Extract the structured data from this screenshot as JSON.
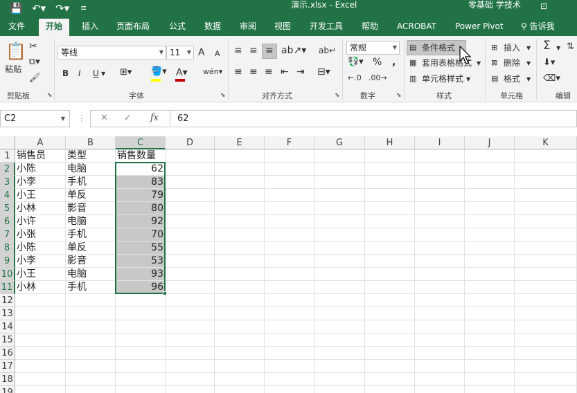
{
  "app": {
    "window_title": "演示.xlsx  -  Excel",
    "user_label": "零基础 学技术"
  },
  "tabs": [
    "文件",
    "开始",
    "插入",
    "页面布局",
    "公式",
    "数据",
    "审阅",
    "视图",
    "开发工具",
    "帮助",
    "ACROBAT",
    "Power Pivot"
  ],
  "active_tab": "开始",
  "tell_me": "告诉我",
  "ribbon": {
    "clipboard": {
      "paste": "粘贴",
      "label": "剪贴板"
    },
    "font": {
      "name": "等线",
      "size": "11",
      "label": "字体",
      "bold": "B",
      "italic": "I",
      "underline": "U",
      "grow": "A",
      "shrink": "A",
      "fill_color": "#ffff00",
      "font_color": "#c00000"
    },
    "alignment": {
      "label": "对齐方式"
    },
    "number": {
      "format": "常规",
      "percent": "%",
      "comma": ",",
      "label": "数字"
    },
    "styles": {
      "conditional": "条件格式",
      "table": "套用表格格式",
      "cell": "单元格样式",
      "label": "样式"
    },
    "cells": {
      "insert": "插入",
      "delete": "删除",
      "format": "格式",
      "label": "单元格"
    },
    "editing": {
      "label": "编辑",
      "sum": "Σ"
    }
  },
  "formula_bar": {
    "name_box": "C2",
    "cancel": "✕",
    "enter": "✓",
    "fx": "fx",
    "value": "62"
  },
  "sheet": {
    "columns": [
      "A",
      "B",
      "C",
      "D",
      "E",
      "F",
      "G",
      "H",
      "I",
      "J",
      "K"
    ],
    "row_numbers": [
      "1",
      "2",
      "3",
      "4",
      "5",
      "6",
      "7",
      "8",
      "9",
      "10",
      "11",
      "12",
      "13",
      "14",
      "15",
      "16",
      "17",
      "18",
      "19"
    ],
    "selected_column": "C",
    "selection": "C2:C11",
    "header": [
      "销售员",
      "类型",
      "销售数量"
    ],
    "rows": [
      [
        "小陈",
        "电脑",
        "62"
      ],
      [
        "小李",
        "手机",
        "83"
      ],
      [
        "小王",
        "单反",
        "79"
      ],
      [
        "小林",
        "影音",
        "80"
      ],
      [
        "小许",
        "电脑",
        "92"
      ],
      [
        "小张",
        "手机",
        "70"
      ],
      [
        "小陈",
        "单反",
        "55"
      ],
      [
        "小李",
        "影音",
        "53"
      ],
      [
        "小王",
        "电脑",
        "93"
      ],
      [
        "小林",
        "手机",
        "96"
      ]
    ]
  },
  "colors": {
    "brand": "#217346",
    "selection_fill": "#c8c8c8"
  }
}
